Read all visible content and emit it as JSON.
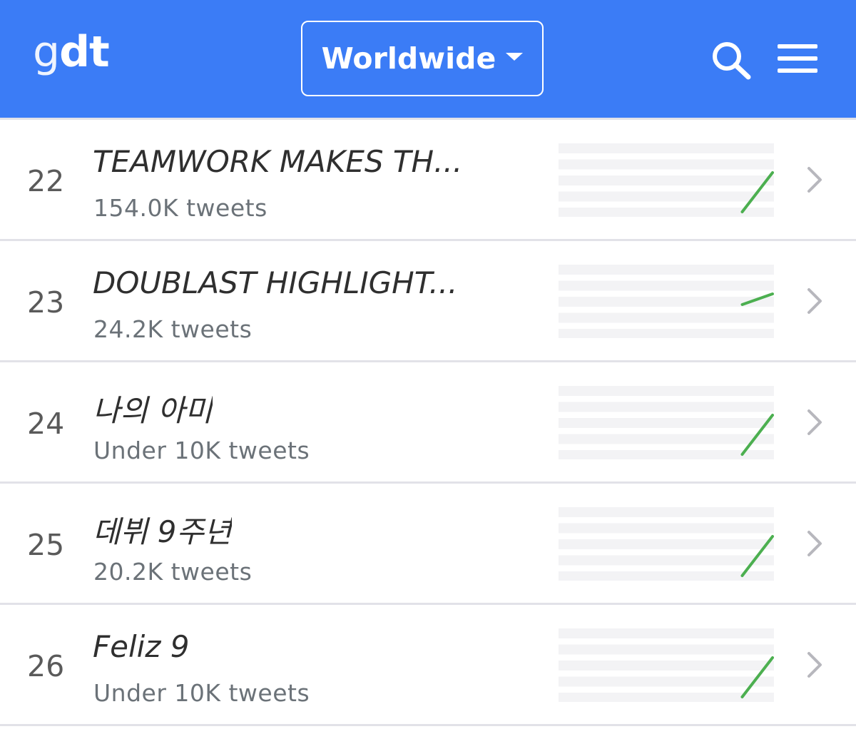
{
  "header": {
    "logo_g": "g",
    "logo_dt": "dt",
    "region": "Worldwide",
    "colors": {
      "background": "#3b7cf6",
      "foreground": "#ffffff"
    },
    "icons": [
      "search-icon",
      "menu-icon",
      "caret-down-icon"
    ]
  },
  "trends": [
    {
      "rank": "22",
      "topic": "TEAMWORK MAKES TH...",
      "count": "154.0K tweets",
      "trend": [
        0,
        0,
        0,
        0,
        0,
        0,
        0.05,
        0.6
      ]
    },
    {
      "rank": "23",
      "topic": "DOUBLAST HIGHLIGHT...",
      "count": "24.2K tweets",
      "trend": [
        0,
        0,
        0,
        0,
        0,
        0,
        0.45,
        0.6
      ]
    },
    {
      "rank": "24",
      "topic": "나의 아미",
      "count": "Under 10K tweets",
      "trend": [
        0,
        0,
        0,
        0,
        0,
        0,
        0.05,
        0.6
      ]
    },
    {
      "rank": "25",
      "topic": "데뷔 9주년",
      "count": "20.2K tweets",
      "trend": [
        0,
        0,
        0,
        0,
        0,
        0,
        0.05,
        0.6
      ]
    },
    {
      "rank": "26",
      "topic": "Feliz 9",
      "count": "Under 10K tweets",
      "trend": [
        0,
        0,
        0,
        0,
        0,
        0,
        0.05,
        0.6
      ]
    }
  ],
  "colors": {
    "trend_line": "#4caf50",
    "spark_band": "#f3f3f5",
    "chevron": "#b7b7bd"
  }
}
